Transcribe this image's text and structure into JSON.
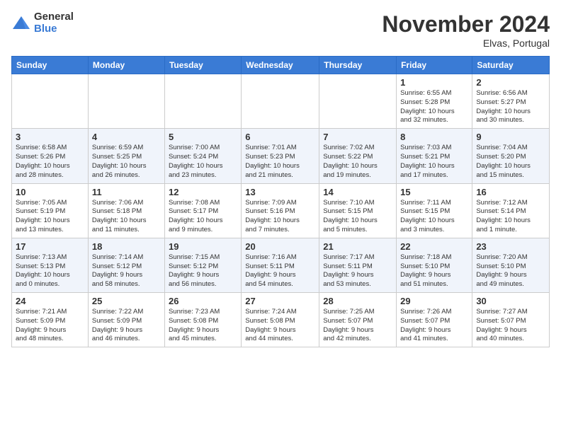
{
  "logo": {
    "general": "General",
    "blue": "Blue"
  },
  "title": "November 2024",
  "location": "Elvas, Portugal",
  "weekdays": [
    "Sunday",
    "Monday",
    "Tuesday",
    "Wednesday",
    "Thursday",
    "Friday",
    "Saturday"
  ],
  "weeks": [
    [
      {
        "day": "",
        "info": ""
      },
      {
        "day": "",
        "info": ""
      },
      {
        "day": "",
        "info": ""
      },
      {
        "day": "",
        "info": ""
      },
      {
        "day": "",
        "info": ""
      },
      {
        "day": "1",
        "info": "Sunrise: 6:55 AM\nSunset: 5:28 PM\nDaylight: 10 hours\nand 32 minutes."
      },
      {
        "day": "2",
        "info": "Sunrise: 6:56 AM\nSunset: 5:27 PM\nDaylight: 10 hours\nand 30 minutes."
      }
    ],
    [
      {
        "day": "3",
        "info": "Sunrise: 6:58 AM\nSunset: 5:26 PM\nDaylight: 10 hours\nand 28 minutes."
      },
      {
        "day": "4",
        "info": "Sunrise: 6:59 AM\nSunset: 5:25 PM\nDaylight: 10 hours\nand 26 minutes."
      },
      {
        "day": "5",
        "info": "Sunrise: 7:00 AM\nSunset: 5:24 PM\nDaylight: 10 hours\nand 23 minutes."
      },
      {
        "day": "6",
        "info": "Sunrise: 7:01 AM\nSunset: 5:23 PM\nDaylight: 10 hours\nand 21 minutes."
      },
      {
        "day": "7",
        "info": "Sunrise: 7:02 AM\nSunset: 5:22 PM\nDaylight: 10 hours\nand 19 minutes."
      },
      {
        "day": "8",
        "info": "Sunrise: 7:03 AM\nSunset: 5:21 PM\nDaylight: 10 hours\nand 17 minutes."
      },
      {
        "day": "9",
        "info": "Sunrise: 7:04 AM\nSunset: 5:20 PM\nDaylight: 10 hours\nand 15 minutes."
      }
    ],
    [
      {
        "day": "10",
        "info": "Sunrise: 7:05 AM\nSunset: 5:19 PM\nDaylight: 10 hours\nand 13 minutes."
      },
      {
        "day": "11",
        "info": "Sunrise: 7:06 AM\nSunset: 5:18 PM\nDaylight: 10 hours\nand 11 minutes."
      },
      {
        "day": "12",
        "info": "Sunrise: 7:08 AM\nSunset: 5:17 PM\nDaylight: 10 hours\nand 9 minutes."
      },
      {
        "day": "13",
        "info": "Sunrise: 7:09 AM\nSunset: 5:16 PM\nDaylight: 10 hours\nand 7 minutes."
      },
      {
        "day": "14",
        "info": "Sunrise: 7:10 AM\nSunset: 5:15 PM\nDaylight: 10 hours\nand 5 minutes."
      },
      {
        "day": "15",
        "info": "Sunrise: 7:11 AM\nSunset: 5:15 PM\nDaylight: 10 hours\nand 3 minutes."
      },
      {
        "day": "16",
        "info": "Sunrise: 7:12 AM\nSunset: 5:14 PM\nDaylight: 10 hours\nand 1 minute."
      }
    ],
    [
      {
        "day": "17",
        "info": "Sunrise: 7:13 AM\nSunset: 5:13 PM\nDaylight: 10 hours\nand 0 minutes."
      },
      {
        "day": "18",
        "info": "Sunrise: 7:14 AM\nSunset: 5:12 PM\nDaylight: 9 hours\nand 58 minutes."
      },
      {
        "day": "19",
        "info": "Sunrise: 7:15 AM\nSunset: 5:12 PM\nDaylight: 9 hours\nand 56 minutes."
      },
      {
        "day": "20",
        "info": "Sunrise: 7:16 AM\nSunset: 5:11 PM\nDaylight: 9 hours\nand 54 minutes."
      },
      {
        "day": "21",
        "info": "Sunrise: 7:17 AM\nSunset: 5:11 PM\nDaylight: 9 hours\nand 53 minutes."
      },
      {
        "day": "22",
        "info": "Sunrise: 7:18 AM\nSunset: 5:10 PM\nDaylight: 9 hours\nand 51 minutes."
      },
      {
        "day": "23",
        "info": "Sunrise: 7:20 AM\nSunset: 5:10 PM\nDaylight: 9 hours\nand 49 minutes."
      }
    ],
    [
      {
        "day": "24",
        "info": "Sunrise: 7:21 AM\nSunset: 5:09 PM\nDaylight: 9 hours\nand 48 minutes."
      },
      {
        "day": "25",
        "info": "Sunrise: 7:22 AM\nSunset: 5:09 PM\nDaylight: 9 hours\nand 46 minutes."
      },
      {
        "day": "26",
        "info": "Sunrise: 7:23 AM\nSunset: 5:08 PM\nDaylight: 9 hours\nand 45 minutes."
      },
      {
        "day": "27",
        "info": "Sunrise: 7:24 AM\nSunset: 5:08 PM\nDaylight: 9 hours\nand 44 minutes."
      },
      {
        "day": "28",
        "info": "Sunrise: 7:25 AM\nSunset: 5:07 PM\nDaylight: 9 hours\nand 42 minutes."
      },
      {
        "day": "29",
        "info": "Sunrise: 7:26 AM\nSunset: 5:07 PM\nDaylight: 9 hours\nand 41 minutes."
      },
      {
        "day": "30",
        "info": "Sunrise: 7:27 AM\nSunset: 5:07 PM\nDaylight: 9 hours\nand 40 minutes."
      }
    ]
  ]
}
